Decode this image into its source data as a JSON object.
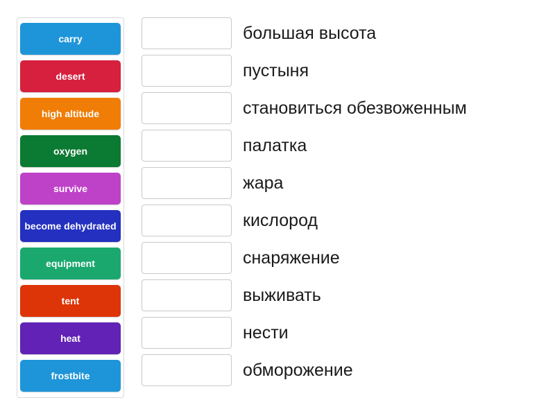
{
  "activity": {
    "type": "match-up",
    "tiles_panel_name": "word-tiles-panel"
  },
  "tiles": [
    {
      "label": "carry",
      "color": "#1f95d9"
    },
    {
      "label": "desert",
      "color": "#d6203e"
    },
    {
      "label": "high altitude",
      "color": "#ef7d06"
    },
    {
      "label": "oxygen",
      "color": "#0b7a32"
    },
    {
      "label": "survive",
      "color": "#be42c8"
    },
    {
      "label": "become dehydrated",
      "color": "#2430c0"
    },
    {
      "label": "equipment",
      "color": "#1aa86e"
    },
    {
      "label": "tent",
      "color": "#dd3508"
    },
    {
      "label": "heat",
      "color": "#6122b5"
    },
    {
      "label": "frostbite",
      "color": "#1f95d9"
    }
  ],
  "answers": [
    {
      "slot_value": "",
      "translation": "большая высота"
    },
    {
      "slot_value": "",
      "translation": "пустыня"
    },
    {
      "slot_value": "",
      "translation": "становиться обезвоженным"
    },
    {
      "slot_value": "",
      "translation": "палатка"
    },
    {
      "slot_value": "",
      "translation": "жара"
    },
    {
      "slot_value": "",
      "translation": "кислород"
    },
    {
      "slot_value": "",
      "translation": "снаряжение"
    },
    {
      "slot_value": "",
      "translation": "выживать"
    },
    {
      "slot_value": "",
      "translation": "нести"
    },
    {
      "slot_value": "",
      "translation": "обморожение"
    }
  ]
}
